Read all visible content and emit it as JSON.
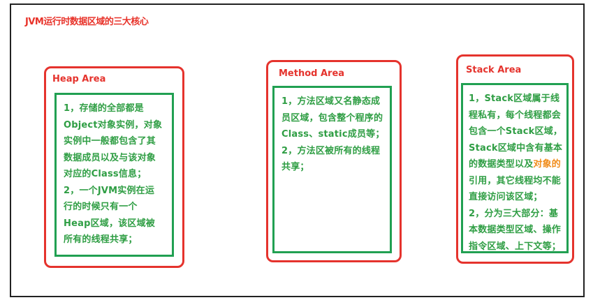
{
  "title": "JVM运行时数据区域的三大核心",
  "heap": {
    "label": "Heap Area",
    "lines": [
      "1，存储的全部都是",
      "Object对象实例，对象",
      "实例中一般都包含了其",
      "数据成员以及与该对象",
      "对应的Class信息；",
      "2，一个JVM实例在运",
      "行的时候只有一个",
      "Heap区域，该区域被",
      "所有的线程共享；"
    ]
  },
  "method": {
    "label": "Method Area",
    "lines": [
      "1，方法区域又名静态成",
      "员区域，包含整个程序的",
      "Class、static成员等；",
      "2，方法区被所有的线程",
      "共享；"
    ]
  },
  "stack": {
    "label": "Stack Area",
    "line1": "1，Stack区域属于线",
    "line2": "程私有，每个线程都会",
    "line3": "包含一个Stack区域，",
    "line4": "Stack区域中含有基本",
    "line5_green": "的数据类型以及",
    "line5_orange": "对象的",
    "line6": "引用，其它线程均不能",
    "line7": "直接访问该区域；",
    "line8": "2，分为三大部分：基",
    "line9": "本数据类型区域、操作",
    "line10": "指令区域、上下文等；"
  },
  "colors": {
    "red": "#e5332d",
    "green": "#21a052",
    "text_green": "#2f9e44",
    "orange": "#f08c1a"
  }
}
